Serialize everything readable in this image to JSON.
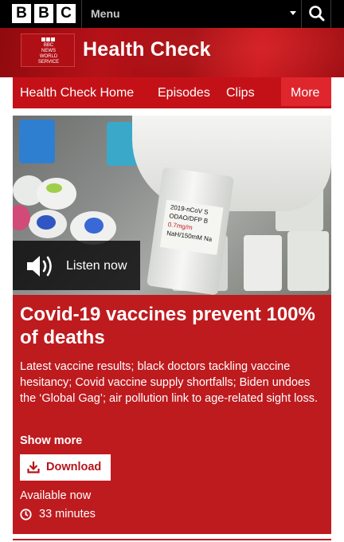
{
  "topbar": {
    "logo_letters": [
      "B",
      "B",
      "C"
    ],
    "menu_label": "Menu",
    "icons": {
      "menu_caret": "caret-down-icon",
      "search": "search-icon"
    }
  },
  "brand": {
    "logo_lines": [
      "BBC",
      "NEWS",
      "WORLD",
      "SERVICE"
    ],
    "title": "Health Check"
  },
  "nav": {
    "items": [
      {
        "label": "Health Check Home"
      },
      {
        "label": "Episodes"
      },
      {
        "label": "Clips"
      }
    ],
    "more_label": "More"
  },
  "episode": {
    "image_label": [
      "2019-nCoV S",
      "ODAO/DFP B",
      "0.7mg/m",
      "NaH/150mM Na"
    ],
    "listen_label": "Listen now",
    "title": "Covid-19 vaccines prevent 100% of deaths",
    "description": "Latest vaccine results; black doctors tackling vaccine hesitancy; Covid vaccine supply shortfalls; Biden undoes the ‘Global Gag’; air pollution link to age-related sight loss.",
    "show_more": "Show more",
    "download_label": "Download",
    "availability": "Available now",
    "duration": "33 minutes"
  },
  "colors": {
    "brand_red": "#be1b1f",
    "nav_red": "#c41118",
    "more_red": "#e0262d",
    "topbar": "#000000"
  }
}
